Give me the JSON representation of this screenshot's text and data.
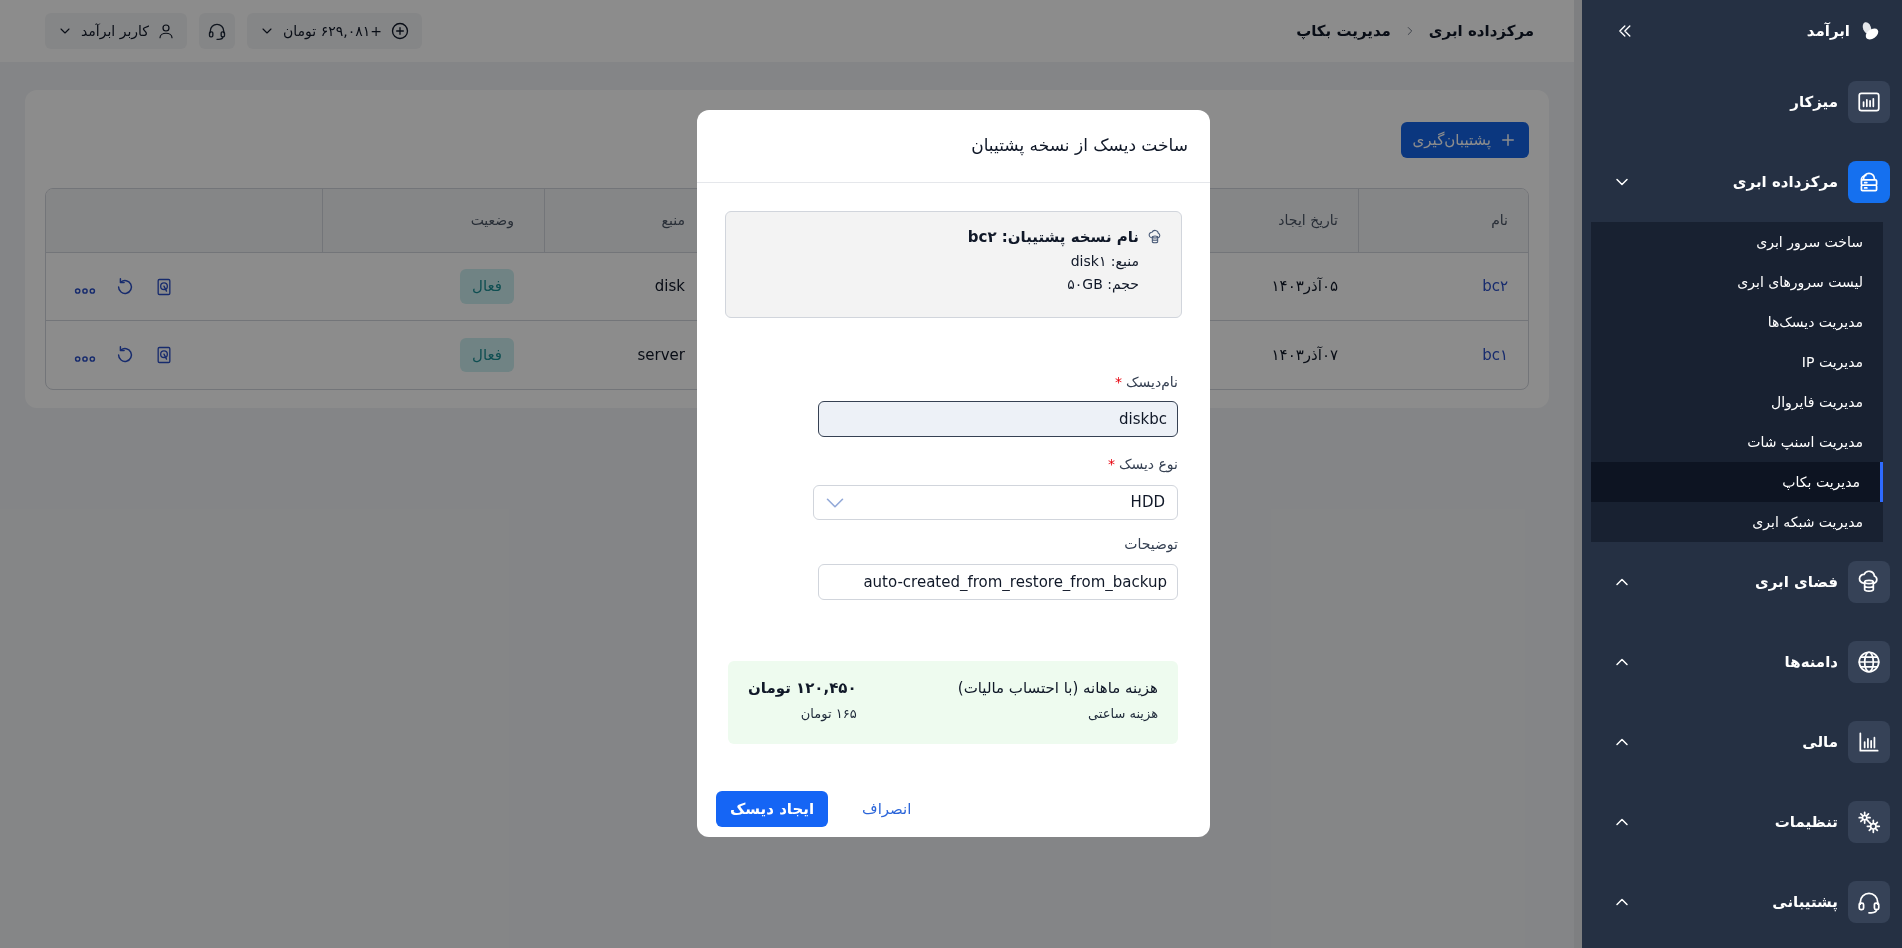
{
  "sidebar": {
    "brand": "ابرآمد",
    "items": [
      {
        "kind": "link",
        "label": "میزکار",
        "selected": false
      },
      {
        "kind": "group",
        "label": "مرکزداده ابری",
        "selected": true,
        "expanded": true,
        "children": [
          {
            "label": "ساخت سرور ابری",
            "selected": false
          },
          {
            "label": "لیست سرورهای ابری",
            "selected": false
          },
          {
            "label": "مدیریت دیسک‌ها",
            "selected": false
          },
          {
            "label": "مدیریت IP",
            "selected": false
          },
          {
            "label": "مدیریت فایروال",
            "selected": false
          },
          {
            "label": "مدیریت اسنپ شات",
            "selected": false
          },
          {
            "label": "مدیریت بکاپ",
            "selected": true
          },
          {
            "label": "مدیریت شبکه ابری",
            "selected": false
          }
        ]
      },
      {
        "kind": "group",
        "label": "فضای ابری",
        "selected": false,
        "expanded": false
      },
      {
        "kind": "group",
        "label": "دامنه‌ها",
        "selected": false,
        "expanded": false
      },
      {
        "kind": "group",
        "label": "مالی",
        "selected": false,
        "expanded": false
      },
      {
        "kind": "group",
        "label": "تنظیمات",
        "selected": false,
        "expanded": false
      },
      {
        "kind": "group",
        "label": "پشتیبانی",
        "selected": false,
        "expanded": false
      }
    ]
  },
  "header": {
    "breadcrumb": [
      "مرکزداده ابری",
      "مدیریت بکاپ"
    ],
    "balance": "+۶۲۹,۰۸۱ تومان",
    "user": "کاربر ابرآمد"
  },
  "backups": {
    "add_button": "پشتیبان‌گیری",
    "table": {
      "columns": [
        "نام",
        "تاریخ ایجاد",
        "منبع",
        "وضعیت"
      ],
      "rows": [
        {
          "name": "bc۲",
          "created": "۰۵آذر۱۴۰۳",
          "source": "disk",
          "status": "فعال"
        },
        {
          "name": "bc۱",
          "created": "۰۷آذر۱۴۰۳",
          "source": "server",
          "status": "فعال"
        }
      ]
    }
  },
  "dialog": {
    "title": "ساخت دیسک از نسخه پشتیبان",
    "backup_info": {
      "name": "نام نسخه پشتیبان: bc۲",
      "source": "منبع: disk۱",
      "size": "حجم: ۵۰GB"
    },
    "fields": [
      {
        "kind": "text",
        "label": "نام‌دیسک",
        "required_mark": "*",
        "value": "diskbc",
        "focused": true
      },
      {
        "kind": "select",
        "label": "نوع دیسک",
        "required_mark": "*",
        "value": "HDD",
        "focused": false
      },
      {
        "kind": "text",
        "label": "توضیحات",
        "value": "auto-created_from_restore_from_backup",
        "focused": false
      }
    ],
    "cost": {
      "title": "هزینه ماهانه (با احتساب مالیات)",
      "amount": "۱۲۰,۴۵۰ تومان",
      "hourly_label": "هزینه ساعتی",
      "hourly_amount": "۱۶۵ تومان"
    },
    "buttons": {
      "submit": "ایجاد دیسک",
      "cancel": "انصراف"
    }
  }
}
